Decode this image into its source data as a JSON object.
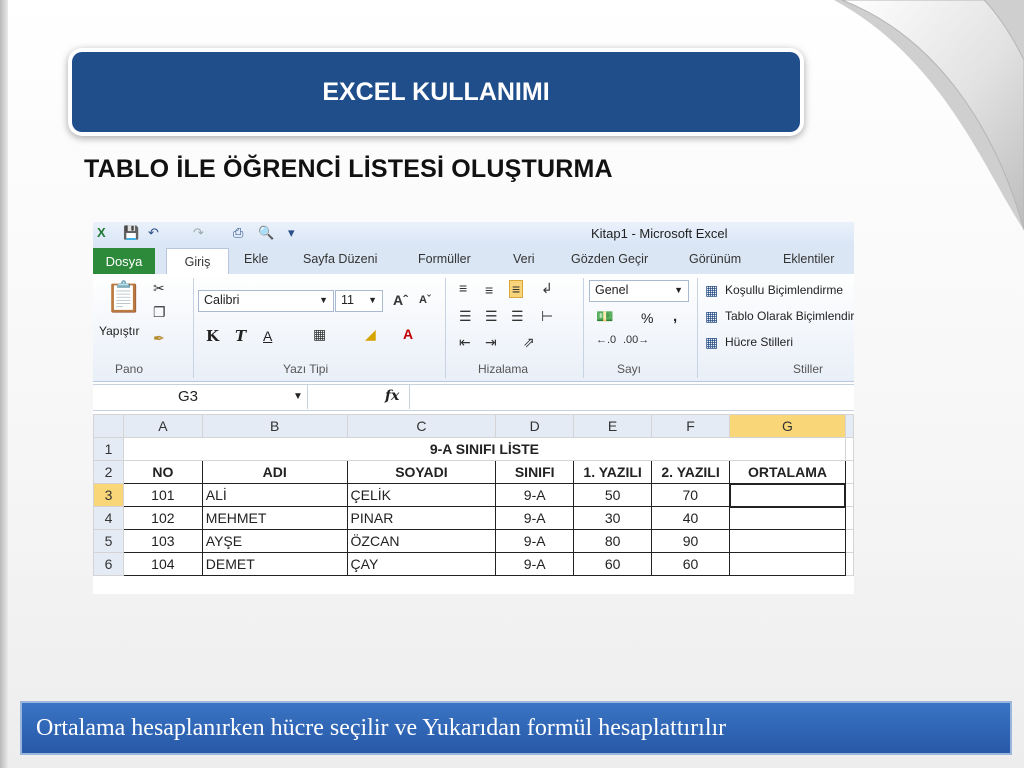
{
  "slide": {
    "title": "EXCEL KULLANIMI",
    "subtitle": "TABLO İLE ÖĞRENCİ LİSTESİ OLUŞTURMA",
    "caption": "Ortalama hesaplanırken hücre seçilir ve Yukarıdan formül hesaplattırılır",
    "colors": {
      "title_bar": "#1f4e8a",
      "caption_bar": "#2e64b4"
    }
  },
  "excel": {
    "window_title": "Kitap1  -  Microsoft Excel",
    "tabs": [
      "Dosya",
      "Giriş",
      "Ekle",
      "Sayfa Düzeni",
      "Formüller",
      "Veri",
      "Gözden Geçir",
      "Görünüm",
      "Eklentiler"
    ],
    "active_tab": "Giriş",
    "ribbon": {
      "paste_label": "Yapıştır",
      "font_name": "Calibri",
      "font_size": "11",
      "bold": "K",
      "italic": "T",
      "underline": "A",
      "number_format": "Genel",
      "percent": "%",
      "comma": ",",
      "conditional_formatting": "Koşullu Biçimlendirme",
      "format_as_table": "Tablo Olarak Biçimlendir",
      "cell_styles": "Hücre Stilleri",
      "groups": [
        "Pano",
        "Yazı Tipi",
        "Hizalama",
        "Sayı",
        "Stiller"
      ]
    },
    "name_box": "G3",
    "fx_label": "fx",
    "columns": [
      "A",
      "B",
      "C",
      "D",
      "E",
      "F",
      "G"
    ],
    "selected_column": "G",
    "selected_row": "3",
    "sheet": {
      "title": "9-A SINIFI LİSTE",
      "headers": [
        "NO",
        "ADI",
        "SOYADI",
        "SINIFI",
        "1. YAZILI",
        "2. YAZILI",
        "ORTALAMA"
      ],
      "rows": [
        [
          "101",
          "ALİ",
          "ÇELİK",
          "9-A",
          "50",
          "70",
          ""
        ],
        [
          "102",
          "MEHMET",
          "PINAR",
          "9-A",
          "30",
          "40",
          ""
        ],
        [
          "103",
          "AYŞE",
          "ÖZCAN",
          "9-A",
          "80",
          "90",
          ""
        ],
        [
          "104",
          "DEMET",
          "ÇAY",
          "9-A",
          "60",
          "60",
          ""
        ]
      ]
    }
  }
}
